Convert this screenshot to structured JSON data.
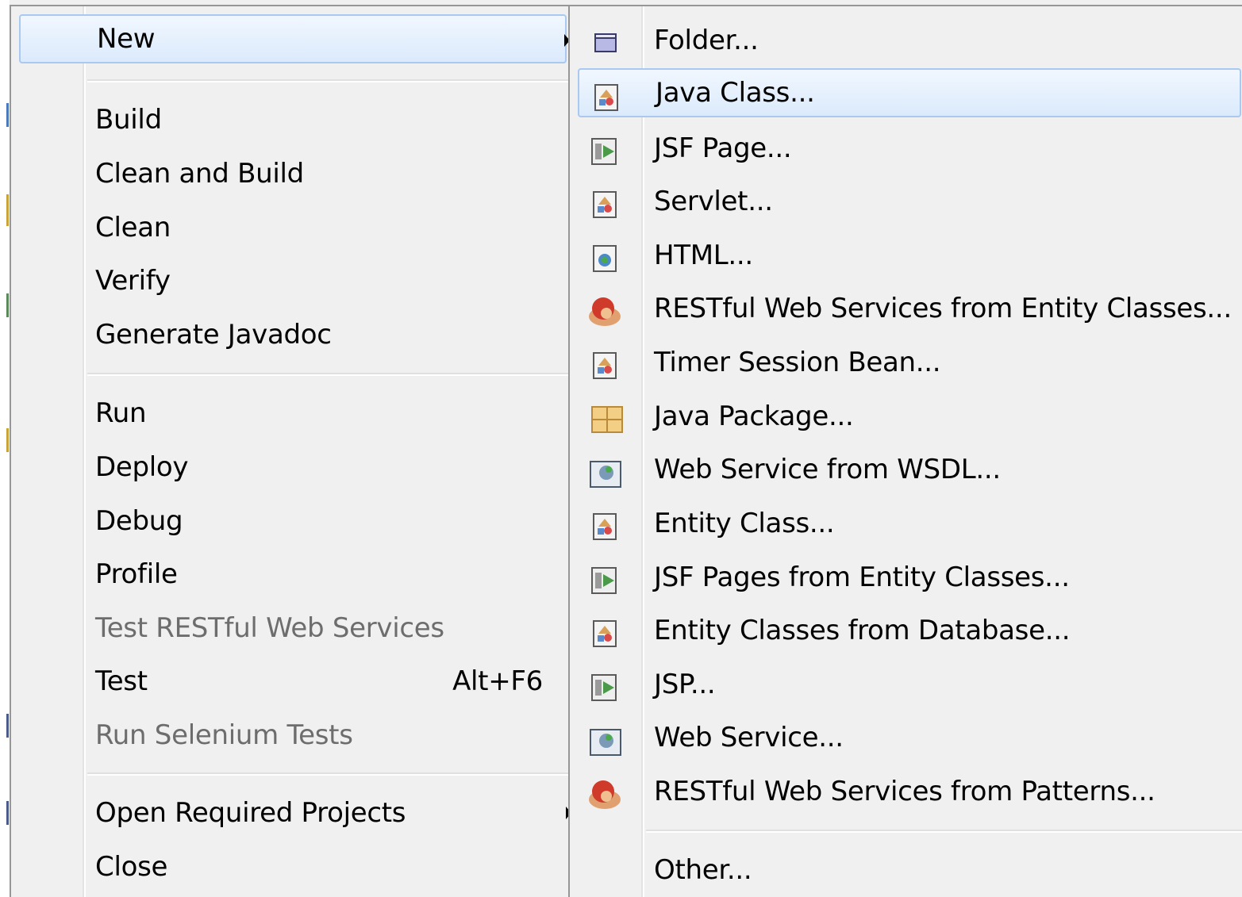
{
  "main_menu": {
    "new": "New",
    "build": "Build",
    "clean_and_build": "Clean and Build",
    "clean": "Clean",
    "verify": "Verify",
    "generate_javadoc": "Generate Javadoc",
    "run": "Run",
    "deploy": "Deploy",
    "debug": "Debug",
    "profile": "Profile",
    "test_restful": "Test RESTful Web Services",
    "test": "Test",
    "test_shortcut": "Alt+F6",
    "run_selenium": "Run Selenium Tests",
    "open_required_projects": "Open Required Projects",
    "close": "Close"
  },
  "new_submenu": {
    "items": [
      {
        "label": "Folder...",
        "icon": "folder-icon"
      },
      {
        "label": "Java Class...",
        "icon": "java-class-icon"
      },
      {
        "label": "JSF Page...",
        "icon": "jsf-page-icon"
      },
      {
        "label": "Servlet...",
        "icon": "servlet-icon"
      },
      {
        "label": "HTML...",
        "icon": "html-file-icon"
      },
      {
        "label": "RESTful Web Services from Entity Classes...",
        "icon": "restful-service-icon"
      },
      {
        "label": "Timer Session Bean...",
        "icon": "session-bean-icon"
      },
      {
        "label": "Java Package...",
        "icon": "java-package-icon"
      },
      {
        "label": "Web Service from WSDL...",
        "icon": "web-service-icon"
      },
      {
        "label": "Entity Class...",
        "icon": "entity-class-icon"
      },
      {
        "label": "JSF Pages from Entity Classes...",
        "icon": "jsf-pages-icon"
      },
      {
        "label": "Entity Classes from Database...",
        "icon": "entity-classes-db-icon"
      },
      {
        "label": "JSP...",
        "icon": "jsp-icon"
      },
      {
        "label": "Web Service...",
        "icon": "web-service-icon"
      },
      {
        "label": "RESTful Web Services from Patterns...",
        "icon": "restful-service-icon"
      },
      {
        "label": "Other...",
        "icon": ""
      }
    ],
    "highlighted": "Java Class..."
  },
  "colors": {
    "menu_bg": "#f0f0f0",
    "highlight_border": "#a9c9f1",
    "disabled_text": "#6d6d6d"
  }
}
